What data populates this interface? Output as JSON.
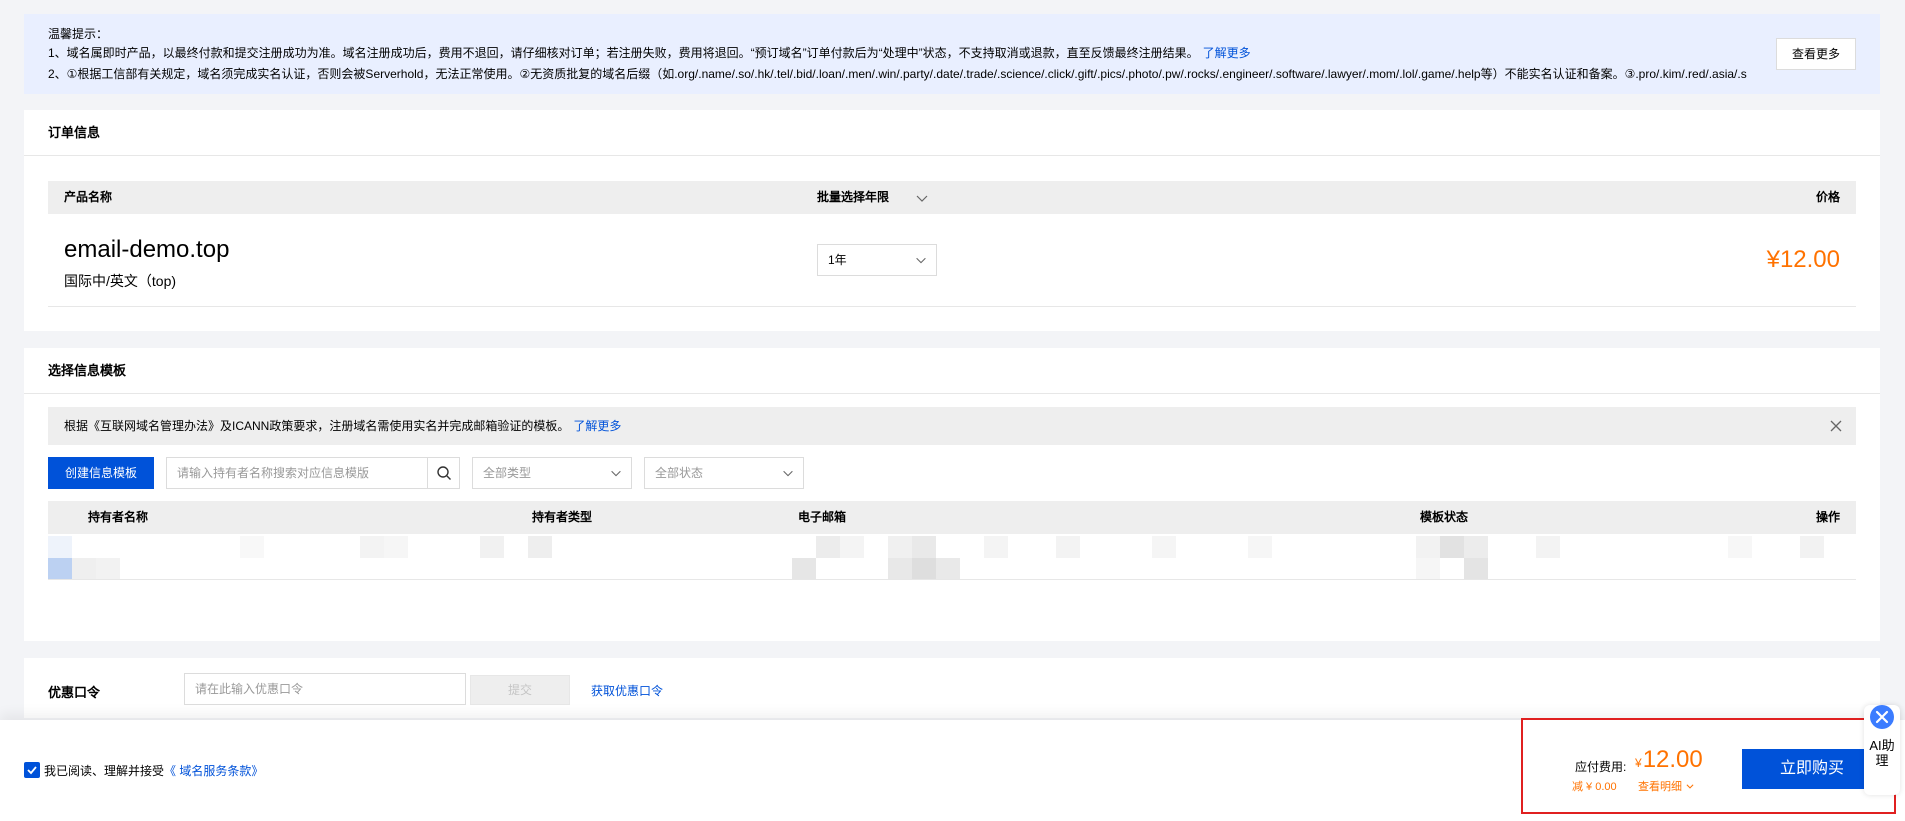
{
  "notice": {
    "title": "温馨提示：",
    "line1": "1、域名属即时产品，以最终付款和提交注册成功为准。域名注册成功后，费用不退回，请仔细核对订单；若注册失败，费用将退回。“预订域名”订单付款后为“处理中”状态，不支持取消或退款，直至反馈最终注册结果。",
    "line1_link": "了解更多",
    "line2": "2、①根据工信部有关规定，域名须完成实名认证，否则会被Serverhold，无法正常使用。②无资质批复的域名后缀（如.org/.name/.so/.hk/.tel/.bid/.loan/.men/.win/.party/.date/.trade/.science/.click/.gift/.pics/.photo/.pw/.rocks/.engineer/.software/.lawyer/.mom/.lol/.game/.help等）不能实名认证和备案。③.pro/.kim/.red/.asia/.s",
    "more_button": "查看更多"
  },
  "order": {
    "title": "订单信息",
    "col_product": "产品名称",
    "col_years": "批量选择年限",
    "col_price": "价格",
    "domain": "email-demo.top",
    "domain_type": "国际中/英文（top)",
    "years_value": "1年",
    "price": "¥12.00"
  },
  "template": {
    "title": "选择信息模板",
    "tip": "根据《互联网域名管理办法》及ICANN政策要求，注册域名需使用实名并完成邮箱验证的模板。",
    "tip_link": "了解更多",
    "create_button": "创建信息模板",
    "search_placeholder": "请输入持有者名称搜索对应信息模版",
    "type_filter": "全部类型",
    "status_filter": "全部状态",
    "col_holder": "持有者名称",
    "col_holder_type": "持有者类型",
    "col_email": "电子邮箱",
    "col_status": "模板状态",
    "col_action": "操作"
  },
  "coupon": {
    "label": "优惠口令",
    "placeholder": "请在此输入优惠口令",
    "submit": "提交",
    "get_link": "获取优惠口令"
  },
  "footer": {
    "agree_text": "我已阅读、理解并接受",
    "agree_link": "《 域名服务条款》",
    "fee_label": "应付费用:",
    "fee_currency": "¥",
    "fee_value": "12.00",
    "discount": "减 ¥ 0.00",
    "detail_link": "查看明细",
    "buy_button": "立即购买"
  },
  "ai_assistant": {
    "label": "AI助理"
  },
  "colors": {
    "primary": "#0052d9",
    "price": "#ff7200",
    "highlight_border": "#e02020"
  }
}
